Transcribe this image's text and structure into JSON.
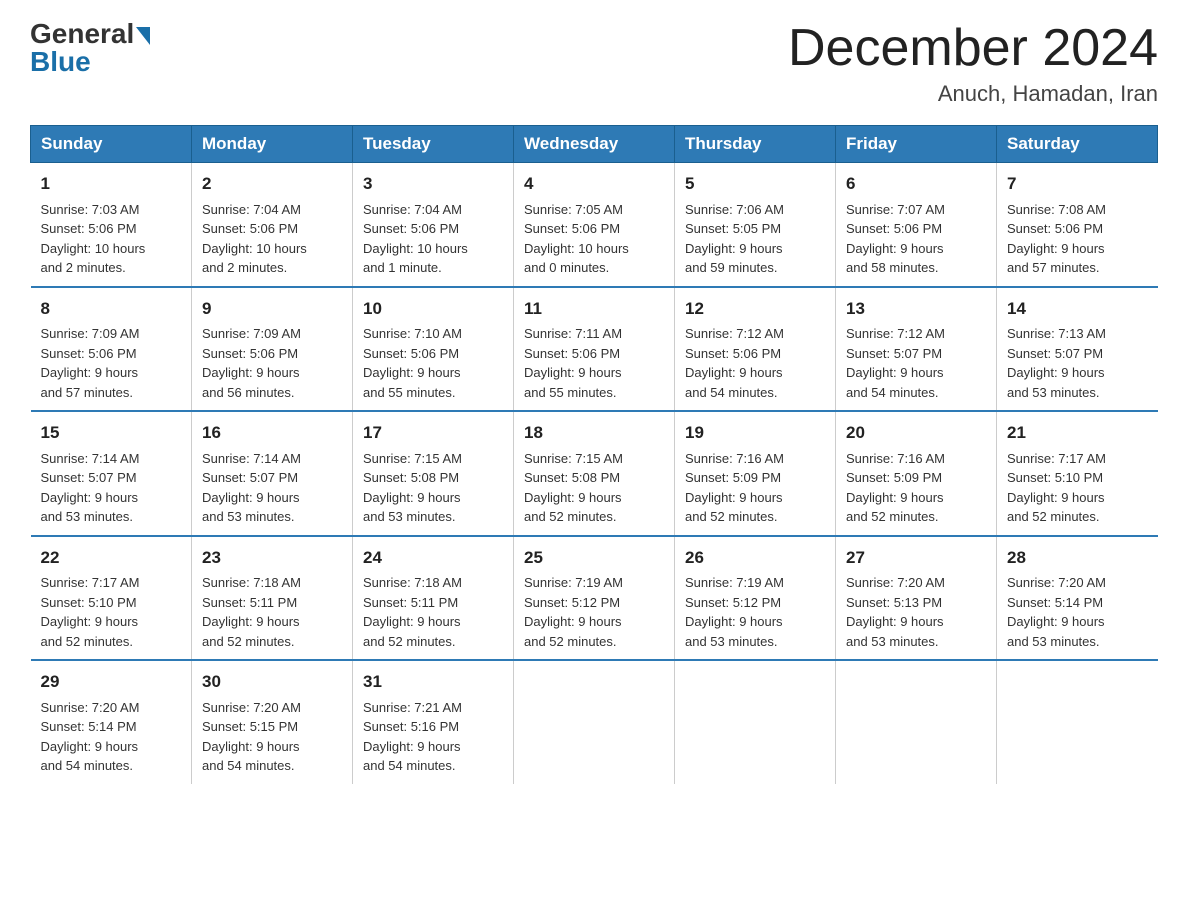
{
  "header": {
    "logo_general": "General",
    "logo_blue": "Blue",
    "month_title": "December 2024",
    "location": "Anuch, Hamadan, Iran"
  },
  "weekdays": [
    "Sunday",
    "Monday",
    "Tuesday",
    "Wednesday",
    "Thursday",
    "Friday",
    "Saturday"
  ],
  "weeks": [
    [
      {
        "day": "1",
        "info": "Sunrise: 7:03 AM\nSunset: 5:06 PM\nDaylight: 10 hours\nand 2 minutes."
      },
      {
        "day": "2",
        "info": "Sunrise: 7:04 AM\nSunset: 5:06 PM\nDaylight: 10 hours\nand 2 minutes."
      },
      {
        "day": "3",
        "info": "Sunrise: 7:04 AM\nSunset: 5:06 PM\nDaylight: 10 hours\nand 1 minute."
      },
      {
        "day": "4",
        "info": "Sunrise: 7:05 AM\nSunset: 5:06 PM\nDaylight: 10 hours\nand 0 minutes."
      },
      {
        "day": "5",
        "info": "Sunrise: 7:06 AM\nSunset: 5:05 PM\nDaylight: 9 hours\nand 59 minutes."
      },
      {
        "day": "6",
        "info": "Sunrise: 7:07 AM\nSunset: 5:06 PM\nDaylight: 9 hours\nand 58 minutes."
      },
      {
        "day": "7",
        "info": "Sunrise: 7:08 AM\nSunset: 5:06 PM\nDaylight: 9 hours\nand 57 minutes."
      }
    ],
    [
      {
        "day": "8",
        "info": "Sunrise: 7:09 AM\nSunset: 5:06 PM\nDaylight: 9 hours\nand 57 minutes."
      },
      {
        "day": "9",
        "info": "Sunrise: 7:09 AM\nSunset: 5:06 PM\nDaylight: 9 hours\nand 56 minutes."
      },
      {
        "day": "10",
        "info": "Sunrise: 7:10 AM\nSunset: 5:06 PM\nDaylight: 9 hours\nand 55 minutes."
      },
      {
        "day": "11",
        "info": "Sunrise: 7:11 AM\nSunset: 5:06 PM\nDaylight: 9 hours\nand 55 minutes."
      },
      {
        "day": "12",
        "info": "Sunrise: 7:12 AM\nSunset: 5:06 PM\nDaylight: 9 hours\nand 54 minutes."
      },
      {
        "day": "13",
        "info": "Sunrise: 7:12 AM\nSunset: 5:07 PM\nDaylight: 9 hours\nand 54 minutes."
      },
      {
        "day": "14",
        "info": "Sunrise: 7:13 AM\nSunset: 5:07 PM\nDaylight: 9 hours\nand 53 minutes."
      }
    ],
    [
      {
        "day": "15",
        "info": "Sunrise: 7:14 AM\nSunset: 5:07 PM\nDaylight: 9 hours\nand 53 minutes."
      },
      {
        "day": "16",
        "info": "Sunrise: 7:14 AM\nSunset: 5:07 PM\nDaylight: 9 hours\nand 53 minutes."
      },
      {
        "day": "17",
        "info": "Sunrise: 7:15 AM\nSunset: 5:08 PM\nDaylight: 9 hours\nand 53 minutes."
      },
      {
        "day": "18",
        "info": "Sunrise: 7:15 AM\nSunset: 5:08 PM\nDaylight: 9 hours\nand 52 minutes."
      },
      {
        "day": "19",
        "info": "Sunrise: 7:16 AM\nSunset: 5:09 PM\nDaylight: 9 hours\nand 52 minutes."
      },
      {
        "day": "20",
        "info": "Sunrise: 7:16 AM\nSunset: 5:09 PM\nDaylight: 9 hours\nand 52 minutes."
      },
      {
        "day": "21",
        "info": "Sunrise: 7:17 AM\nSunset: 5:10 PM\nDaylight: 9 hours\nand 52 minutes."
      }
    ],
    [
      {
        "day": "22",
        "info": "Sunrise: 7:17 AM\nSunset: 5:10 PM\nDaylight: 9 hours\nand 52 minutes."
      },
      {
        "day": "23",
        "info": "Sunrise: 7:18 AM\nSunset: 5:11 PM\nDaylight: 9 hours\nand 52 minutes."
      },
      {
        "day": "24",
        "info": "Sunrise: 7:18 AM\nSunset: 5:11 PM\nDaylight: 9 hours\nand 52 minutes."
      },
      {
        "day": "25",
        "info": "Sunrise: 7:19 AM\nSunset: 5:12 PM\nDaylight: 9 hours\nand 52 minutes."
      },
      {
        "day": "26",
        "info": "Sunrise: 7:19 AM\nSunset: 5:12 PM\nDaylight: 9 hours\nand 53 minutes."
      },
      {
        "day": "27",
        "info": "Sunrise: 7:20 AM\nSunset: 5:13 PM\nDaylight: 9 hours\nand 53 minutes."
      },
      {
        "day": "28",
        "info": "Sunrise: 7:20 AM\nSunset: 5:14 PM\nDaylight: 9 hours\nand 53 minutes."
      }
    ],
    [
      {
        "day": "29",
        "info": "Sunrise: 7:20 AM\nSunset: 5:14 PM\nDaylight: 9 hours\nand 54 minutes."
      },
      {
        "day": "30",
        "info": "Sunrise: 7:20 AM\nSunset: 5:15 PM\nDaylight: 9 hours\nand 54 minutes."
      },
      {
        "day": "31",
        "info": "Sunrise: 7:21 AM\nSunset: 5:16 PM\nDaylight: 9 hours\nand 54 minutes."
      },
      {
        "day": "",
        "info": ""
      },
      {
        "day": "",
        "info": ""
      },
      {
        "day": "",
        "info": ""
      },
      {
        "day": "",
        "info": ""
      }
    ]
  ]
}
